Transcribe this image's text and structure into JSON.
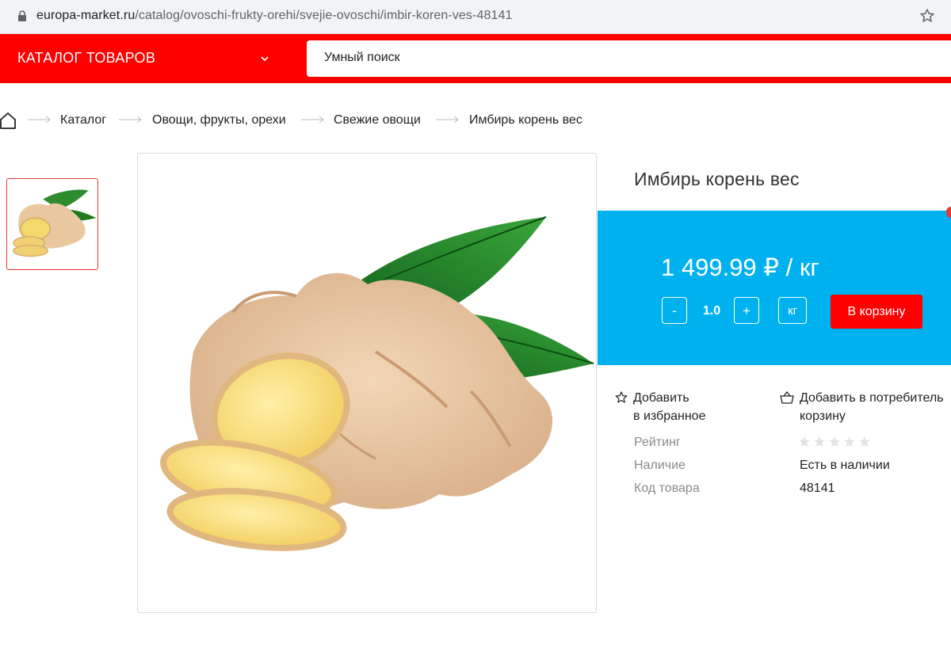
{
  "browser": {
    "url_host": "europa-market.ru",
    "url_path": "/catalog/ovoschi-frukty-orehi/svejie-ovoschi/imbir-koren-ves-48141"
  },
  "header": {
    "catalog_label": "КАТАЛОГ ТОВАРОВ",
    "search_placeholder": "Умный поиск"
  },
  "breadcrumb": {
    "items": [
      "Каталог",
      "Овощи, фрукты, орехи",
      "Свежие овощи",
      "Имбирь корень вес"
    ]
  },
  "product": {
    "title": "Имбирь корень вес",
    "price": "1 499.99 ₽ / кг",
    "quantity": "1.0",
    "minus_label": "-",
    "plus_label": "+",
    "unit_label": "кг",
    "cart_label": "В корзину"
  },
  "actions": {
    "favorite_line1": "Добавить",
    "favorite_line2": "в избранное",
    "basket_line1": "Добавить в потребитель",
    "basket_line2": "корзину"
  },
  "info": {
    "rating_label": "Рейтинг",
    "rating_value": 0,
    "rating_max": 5,
    "availability_label": "Наличие",
    "availability_value": "Есть в наличии",
    "code_label": "Код товара",
    "code_value": "48141"
  },
  "colors": {
    "brand_red": "#ff0000",
    "price_panel_blue": "#00b1ef"
  }
}
